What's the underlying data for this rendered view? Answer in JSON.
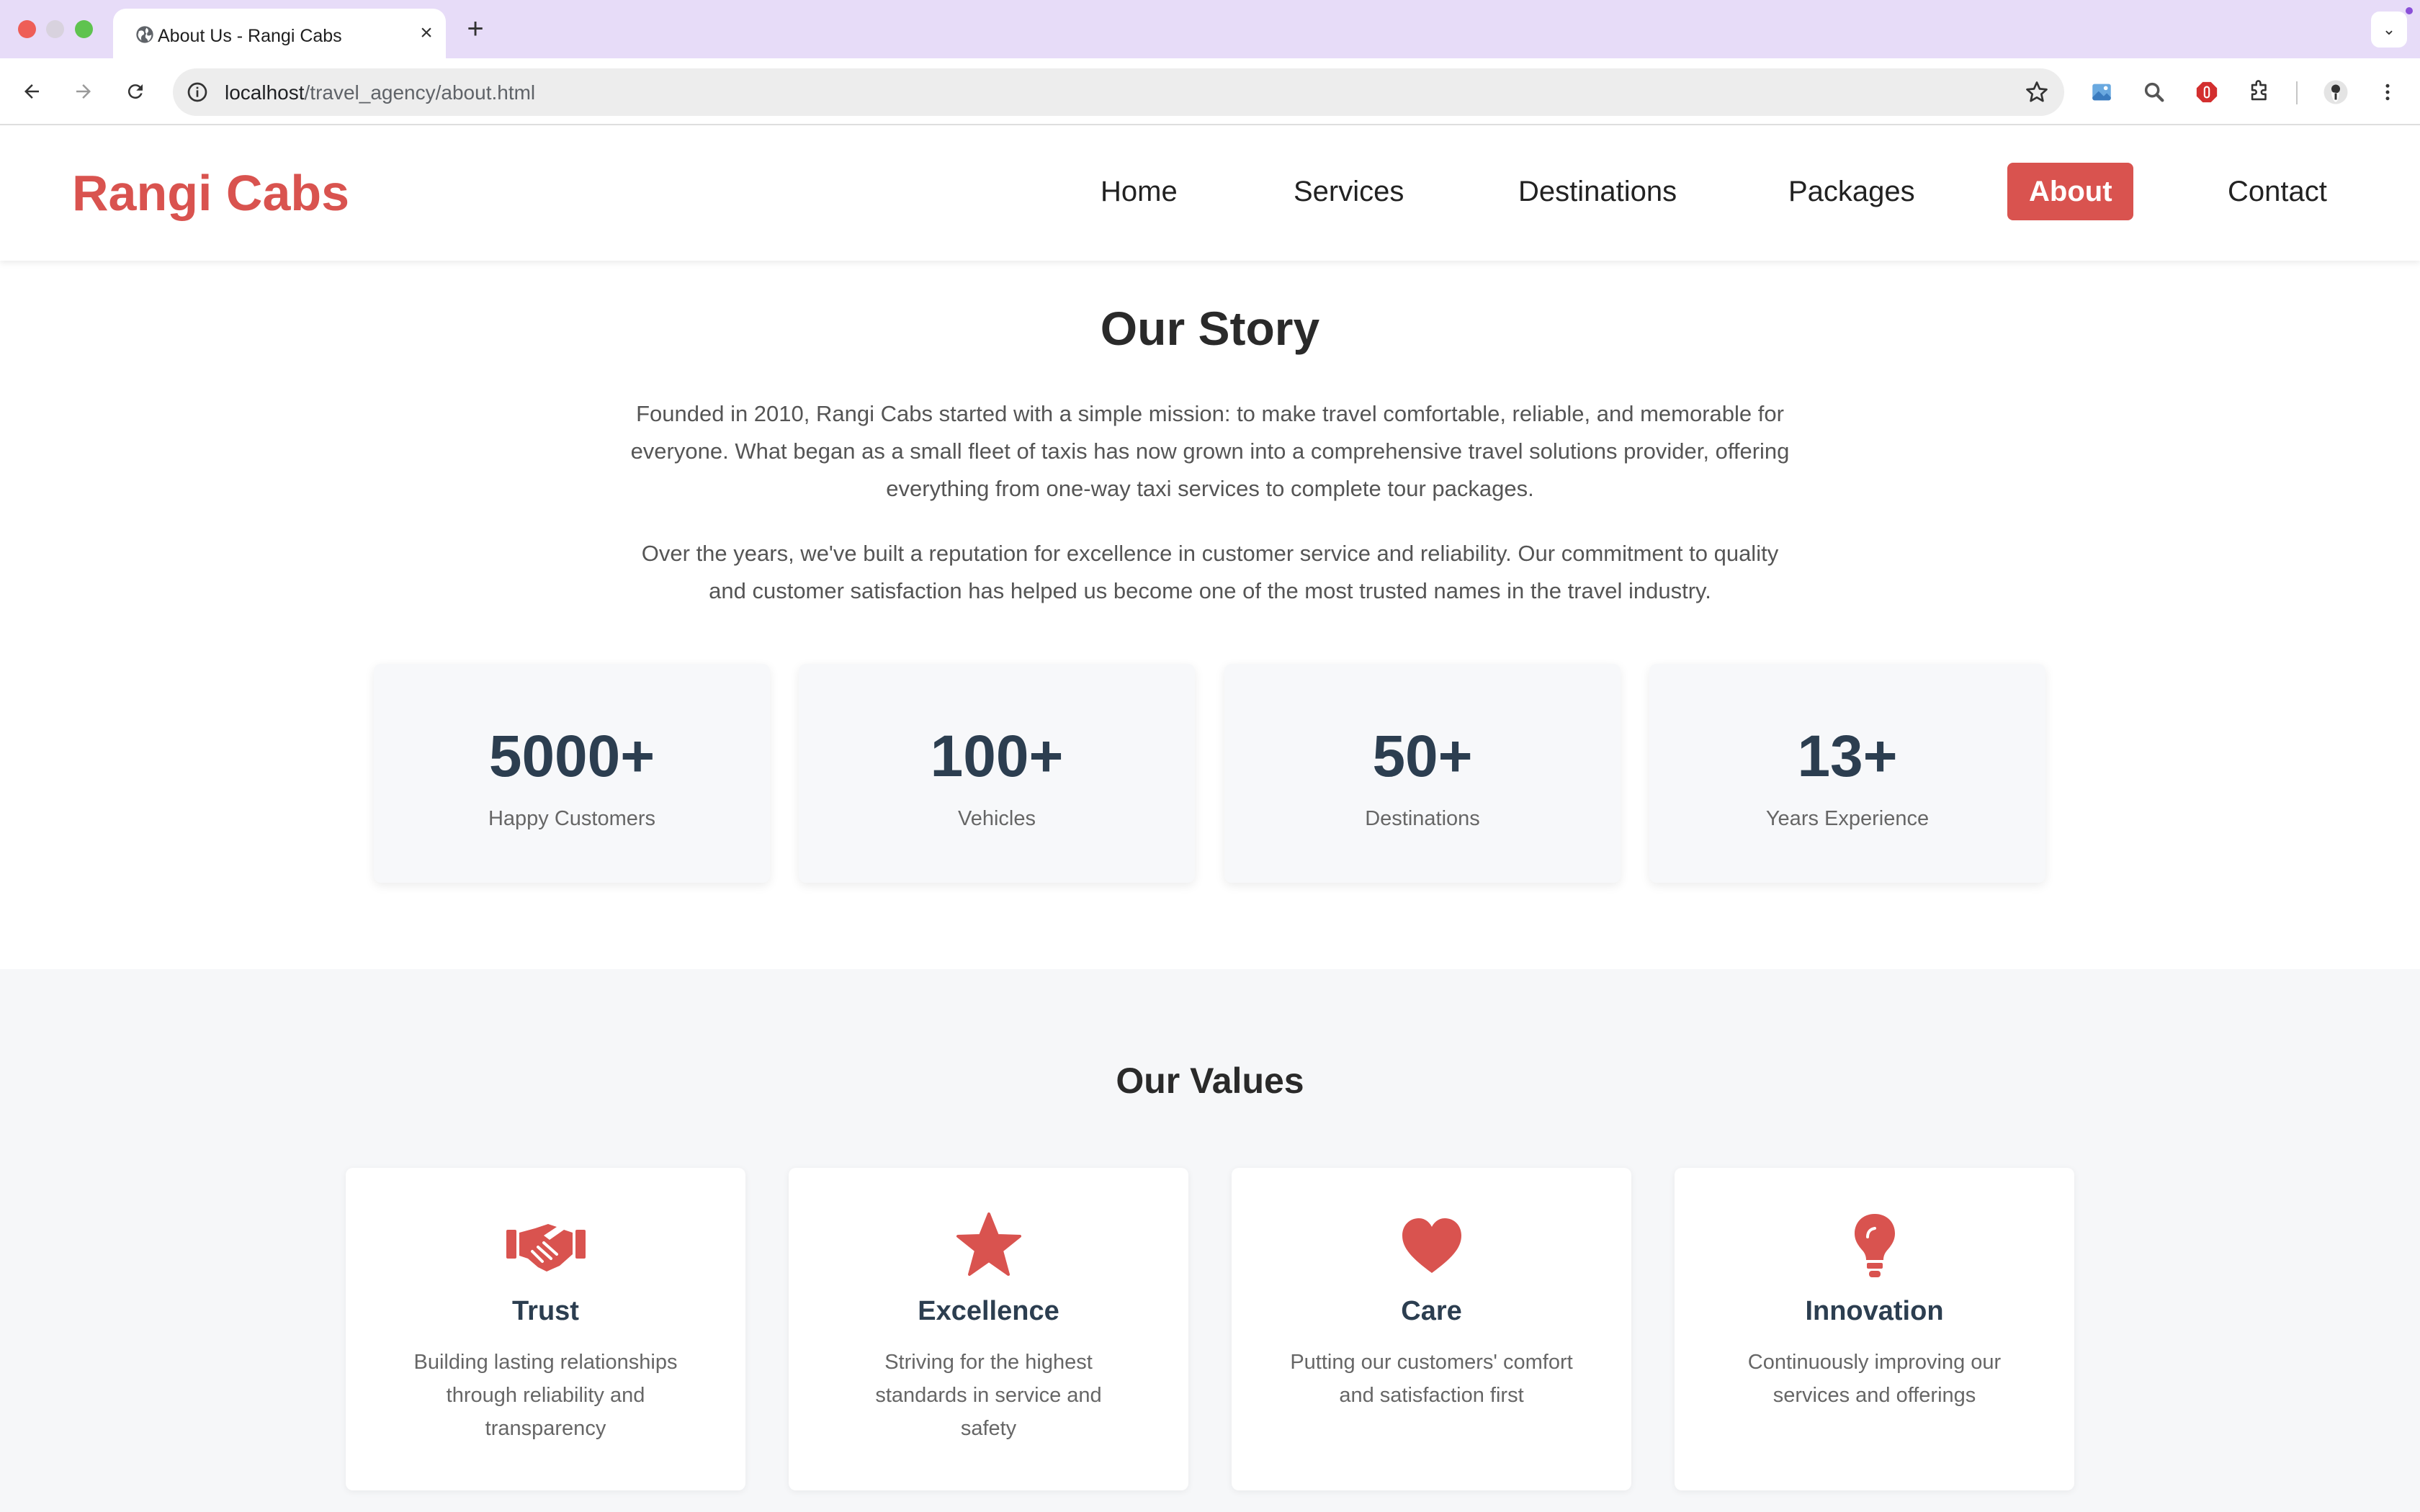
{
  "browser": {
    "tab_title": "About Us - Rangi Cabs",
    "tab_close": "×",
    "new_tab": "+",
    "tab_search": "⌄",
    "url_host": "localhost",
    "url_path": "/travel_agency/about.html"
  },
  "site": {
    "brand": "Rangi Cabs",
    "nav": [
      {
        "label": "Home"
      },
      {
        "label": "Services"
      },
      {
        "label": "Destinations"
      },
      {
        "label": "Packages"
      },
      {
        "label": "About"
      },
      {
        "label": "Contact"
      }
    ],
    "active_nav": "About"
  },
  "story": {
    "title": "Our Story",
    "paragraph1": "Founded in 2010, Rangi Cabs started with a simple mission: to make travel comfortable, reliable, and memorable for everyone. What began as a small fleet of taxis has now grown into a comprehensive travel solutions provider, offering everything from one-way taxi services to complete tour packages.",
    "paragraph2": "Over the years, we've built a reputation for excellence in customer service and reliability. Our commitment to quality and customer satisfaction has helped us become one of the most trusted names in the travel industry."
  },
  "stats": [
    {
      "value": "5000+",
      "label": "Happy Customers"
    },
    {
      "value": "100+",
      "label": "Vehicles"
    },
    {
      "value": "50+",
      "label": "Destinations"
    },
    {
      "value": "13+",
      "label": "Years Experience"
    }
  ],
  "values": {
    "title": "Our Values",
    "items": [
      {
        "icon": "handshake-icon",
        "title": "Trust",
        "description": "Building lasting relationships through reliability and transparency"
      },
      {
        "icon": "star-icon",
        "title": "Excellence",
        "description": "Striving for the highest standards in service and safety"
      },
      {
        "icon": "heart-icon",
        "title": "Care",
        "description": "Putting our customers' comfort and satisfaction first"
      },
      {
        "icon": "lightbulb-icon",
        "title": "Innovation",
        "description": "Continuously improving our services and offerings"
      }
    ]
  },
  "colors": {
    "brand": "#d9534f",
    "tab_strip": "#e7dcf8",
    "stat_number": "#2c3e50"
  }
}
